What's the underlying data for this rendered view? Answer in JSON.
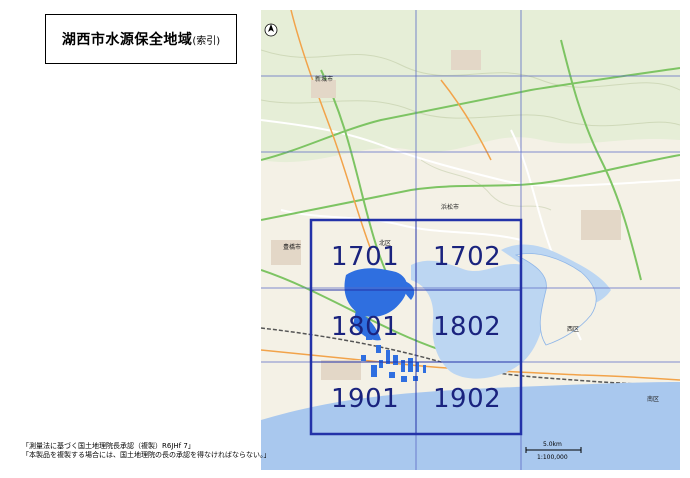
{
  "title": {
    "main": "湖西市水源保全地域",
    "sub": "(索引)"
  },
  "grid_cells": [
    {
      "id": "1701"
    },
    {
      "id": "1702"
    },
    {
      "id": "1801"
    },
    {
      "id": "1802"
    },
    {
      "id": "1901"
    },
    {
      "id": "1902"
    }
  ],
  "places": {
    "shinshiro": "新城市",
    "hamamatsu": "浜松市",
    "toyohashi": "豊橋市",
    "kita_ku": "北区",
    "nishi_ku": "西区",
    "minami_ku": "南区"
  },
  "scale": {
    "distance": "5.0km",
    "ratio": "1:100,000"
  },
  "notes": [
    "「測量法に基づく国土地理院長承認（複製）R6JHf 7」",
    "「本製品を複製する場合には、国土地理院の長の承認を得なければならない。」"
  ],
  "colors": {
    "grid_blue": "#2332a8",
    "water": "#bcd6f2",
    "sea": "#a9c8ee",
    "protection_area": "#2f6fe0",
    "land": "#f4f1e6",
    "forest": "#e6eed7",
    "label": "#1a237e"
  }
}
